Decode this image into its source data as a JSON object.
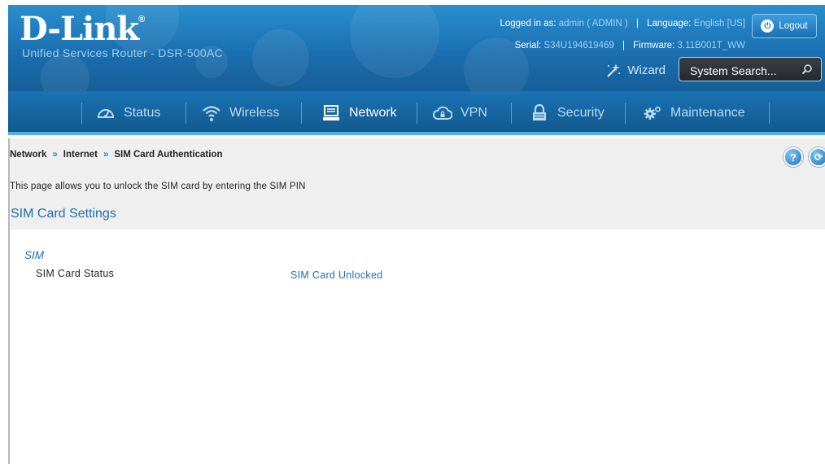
{
  "header": {
    "logo_text": "D-Link",
    "logo_mark": "®",
    "subtitle": "Unified Services Router - DSR-500AC",
    "logged_in_label": "Logged in as:",
    "logged_in_value": "admin ( ADMIN )",
    "language_label": "Language:",
    "language_value": "English [US]",
    "serial_label": "Serial:",
    "serial_value": "S34U194619469",
    "firmware_label": "Firmware:",
    "firmware_value": "3.11B001T_WW",
    "logout_label": "Logout",
    "wizard_label": "Wizard",
    "search_placeholder": "System Search...",
    "brand_color": "#1b6fb0"
  },
  "nav": {
    "items": [
      {
        "label": "Status",
        "icon": "gauge-icon"
      },
      {
        "label": "Wireless",
        "icon": "wifi-icon"
      },
      {
        "label": "Network",
        "icon": "computer-icon",
        "active": true
      },
      {
        "label": "VPN",
        "icon": "cloud-lock-icon"
      },
      {
        "label": "Security",
        "icon": "lock-icon"
      },
      {
        "label": "Maintenance",
        "icon": "gears-icon"
      }
    ]
  },
  "breadcrumb": {
    "items": [
      "Network",
      "Internet",
      "SIM Card Authentication"
    ],
    "separator": "»"
  },
  "page": {
    "description": "This page allows you to unlock the SIM card by entering the SIM PIN",
    "section_title": "SIM Card Settings",
    "sub_heading": "SIM",
    "fields": [
      {
        "label": "SIM Card Status",
        "value": "SIM Card Unlocked"
      }
    ]
  }
}
